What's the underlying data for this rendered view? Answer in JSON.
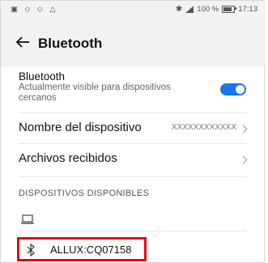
{
  "status_bar": {
    "left_icons": "▣ ⬦ ⬦ △",
    "battery_text": "100 %",
    "time": "17:13"
  },
  "header": {
    "title": "Bluetooth"
  },
  "bluetooth_row": {
    "label": "Bluetooth",
    "description": "Actualmente visible para dispositivos cercanos",
    "enabled": true
  },
  "device_name_row": {
    "label": "Nombre del dispositivo",
    "value": "XXXXXXXXXXXX"
  },
  "received_files_row": {
    "label": "Archivos recibidos"
  },
  "available_devices": {
    "section_title": "DISPOSITIVOS DISPONIBLES",
    "devices": [
      {
        "name": "",
        "icon": "laptop-icon"
      },
      {
        "name": "ALLUX:CQ07158",
        "icon": "bluetooth-icon",
        "highlighted": true
      }
    ]
  },
  "colors": {
    "accent": "#1b74e8",
    "highlight_border": "#e30613"
  }
}
